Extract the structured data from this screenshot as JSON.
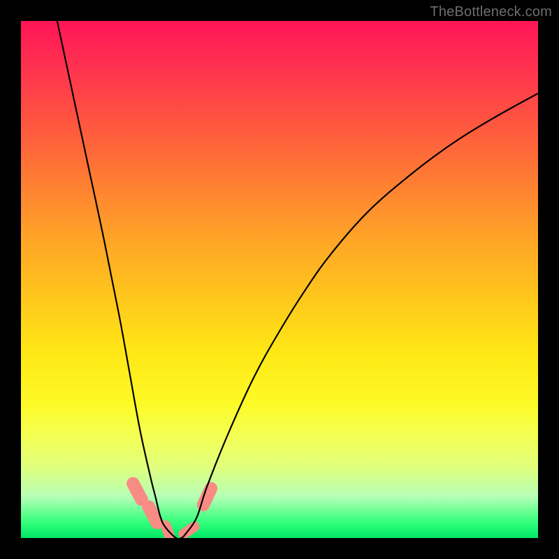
{
  "watermark": "TheBottleneck.com",
  "chart_data": {
    "type": "line",
    "title": "",
    "xlabel": "",
    "ylabel": "",
    "xlim": [
      0,
      100
    ],
    "ylim": [
      0,
      100
    ],
    "series": [
      {
        "name": "bottleneck-curve",
        "x": [
          7,
          10,
          13,
          16,
          19,
          21,
          23,
          25,
          26,
          27,
          28,
          30,
          31,
          32,
          34,
          36,
          40,
          45,
          50,
          55,
          60,
          67,
          75,
          83,
          91,
          100
        ],
        "y": [
          100,
          86,
          72,
          58,
          43,
          32,
          21,
          12,
          8,
          4,
          2,
          0,
          0,
          1,
          4,
          10,
          20,
          31,
          40,
          48,
          55,
          63,
          70,
          76,
          81,
          86
        ]
      }
    ],
    "markers": [
      {
        "name": "pink-marker-1",
        "x": 22.5,
        "y": 9,
        "w": 2.5,
        "h": 6,
        "angle": -28,
        "color": "#f98b85"
      },
      {
        "name": "pink-marker-2",
        "x": 25.5,
        "y": 4.5,
        "w": 2.5,
        "h": 6,
        "angle": -28,
        "color": "#f98b85"
      },
      {
        "name": "pink-marker-3",
        "x": 28.5,
        "y": 1,
        "w": 2.0,
        "h": 5,
        "angle": -20,
        "color": "#f98b85"
      },
      {
        "name": "pink-marker-4",
        "x": 32.5,
        "y": 1.5,
        "w": 2.0,
        "h": 4.5,
        "angle": 55,
        "color": "#f98b85"
      },
      {
        "name": "pink-marker-5",
        "x": 36.0,
        "y": 8,
        "w": 2.5,
        "h": 6,
        "angle": 25,
        "color": "#f98b85"
      }
    ],
    "background_gradient": {
      "top": "#ff1556",
      "mid": "#ffe716",
      "bottom": "#00e768"
    }
  }
}
